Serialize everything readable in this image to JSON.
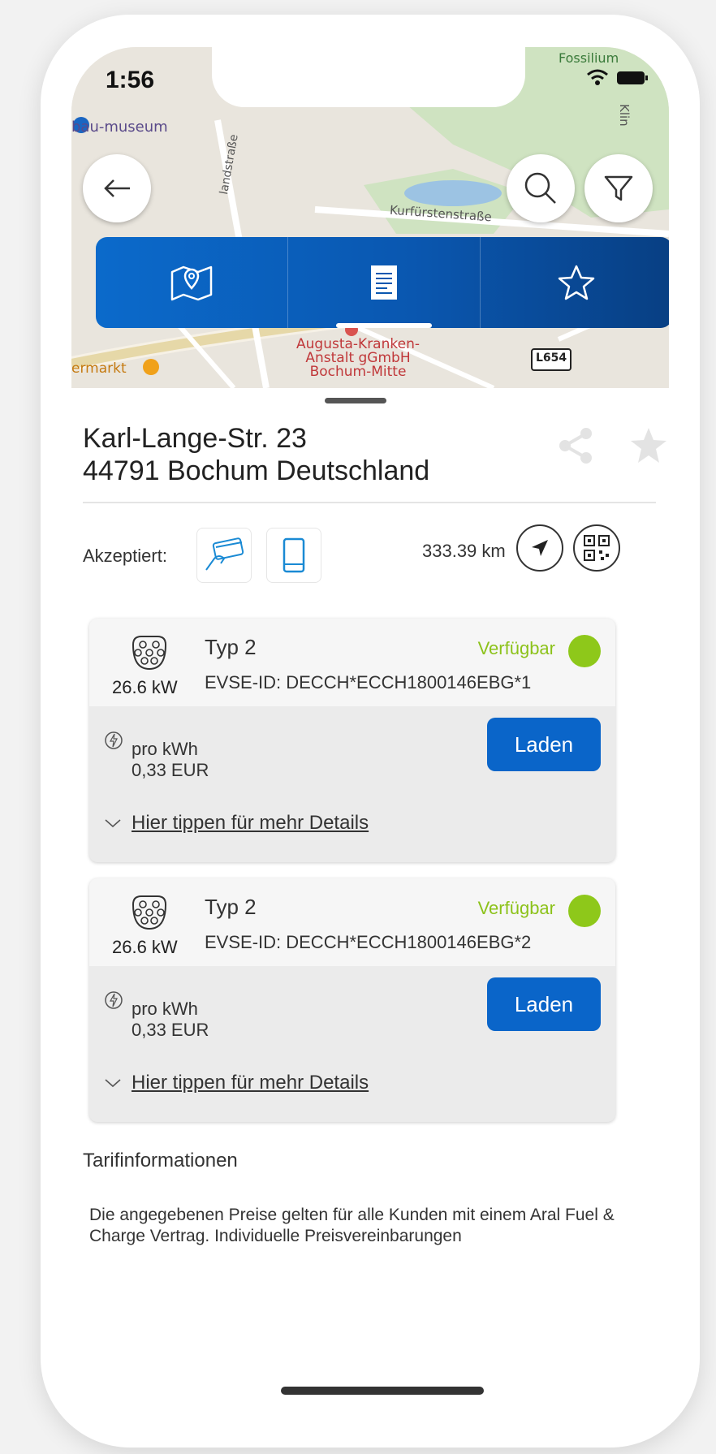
{
  "status": {
    "time": "1:56"
  },
  "map": {
    "labels": {
      "museum": "bau-museum",
      "street1": "landstraße",
      "street2": "Kurfürstenstraße",
      "hospital": [
        "Augusta-Kranken-",
        "Anstalt gGmbH",
        "Bochum-Mitte"
      ],
      "road": "L654",
      "market": "ermarkt",
      "fossil": "Fossilium",
      "clinic": "Klin"
    }
  },
  "tabs": [
    {
      "icon": "map-pin-icon"
    },
    {
      "icon": "list-document-icon",
      "active": true
    },
    {
      "icon": "star-outline-icon"
    }
  ],
  "station": {
    "address_line1": "Karl-Lange-Str. 23",
    "address_line2": "44791 Bochum Deutschland",
    "accept_label": "Akzeptiert:",
    "distance": "333.39 km"
  },
  "connectors": [
    {
      "type": "Typ 2",
      "power": "26.6 kW",
      "evse": "EVSE-ID: DECCH*ECCH1800146EBG*1",
      "status": "Verfügbar",
      "price_label": "pro kWh",
      "price": "0,33 EUR",
      "action": "Laden",
      "details": "Hier tippen für mehr Details"
    },
    {
      "type": "Typ 2",
      "power": "26.6 kW",
      "evse": "EVSE-ID: DECCH*ECCH1800146EBG*2",
      "status": "Verfügbar",
      "price_label": "pro kWh",
      "price": "0,33 EUR",
      "action": "Laden",
      "details": "Hier tippen für mehr Details"
    }
  ],
  "tarif": {
    "title": "Tarifinformationen",
    "text": "Die angegebenen Preise gelten für alle Kunden mit einem Aral Fuel & Charge Vertrag. Individuelle Preisvereinbarungen"
  },
  "colors": {
    "primary": "#0a65c9",
    "available": "#8ec81a"
  }
}
